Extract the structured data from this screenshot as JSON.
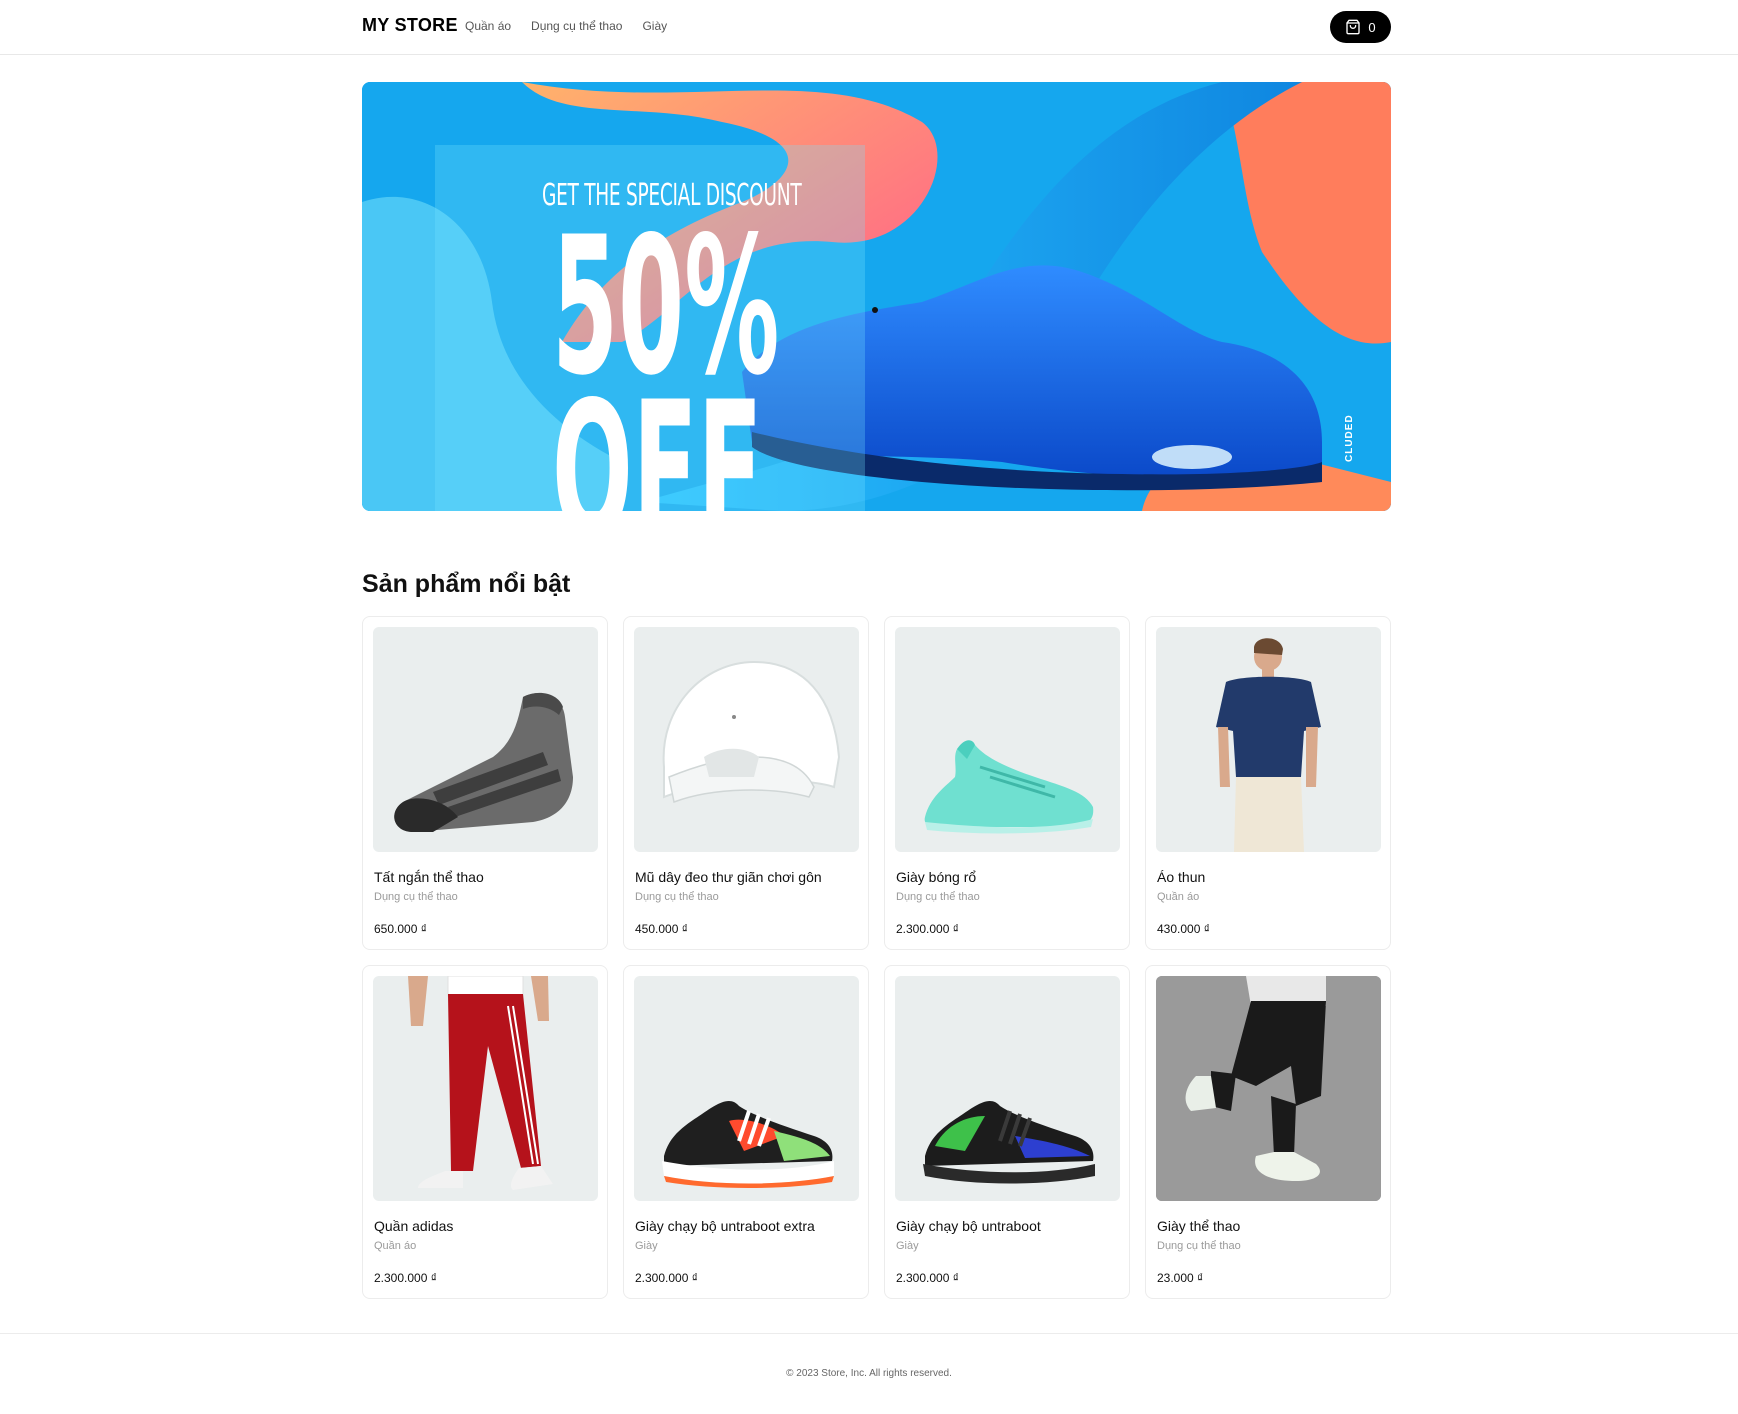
{
  "header": {
    "logo": "MY STORE",
    "nav": [
      "Quần áo",
      "Dụng cụ thể thao",
      "Giày"
    ],
    "cart_count": "0"
  },
  "banner": {
    "headline": "GET THE SPECIAL DISCOUNT",
    "percent": "50%",
    "off": "OFF",
    "side_text": "CLUDED"
  },
  "section_title": "Sản phẩm nổi bật",
  "products": [
    {
      "name": "Tất ngắn thể thao",
      "category": "Dụng cụ thể thao",
      "price": "650.000 ₫",
      "icon": "sock-icon"
    },
    {
      "name": "Mũ dây đeo thư giãn chơi gôn",
      "category": "Dụng cụ thể thao",
      "price": "450.000 ₫",
      "icon": "cap-icon"
    },
    {
      "name": "Giày bóng rổ",
      "category": "Dụng cụ thể thao",
      "price": "2.300.000 ₫",
      "icon": "basketball-shoe-icon"
    },
    {
      "name": "Áo thun",
      "category": "Quần áo",
      "price": "430.000 ₫",
      "icon": "tshirt-model-icon"
    },
    {
      "name": "Quần adidas",
      "category": "Quần áo",
      "price": "2.300.000 ₫",
      "icon": "pants-model-icon"
    },
    {
      "name": "Giày chạy bộ untraboot extra",
      "category": "Giày",
      "price": "2.300.000 ₫",
      "icon": "running-shoe-icon"
    },
    {
      "name": "Giày chạy bộ untraboot",
      "category": "Giày",
      "price": "2.300.000 ₫",
      "icon": "running-shoe-dark-icon"
    },
    {
      "name": "Giày thể thao",
      "category": "Dụng cụ thể thao",
      "price": "23.000 ₫",
      "icon": "sneaker-model-icon"
    }
  ],
  "footer": "© 2023 Store, Inc. All rights reserved.",
  "colors": {
    "banner_blue": "#15a7ee",
    "banner_orange": "#ff7d5c",
    "product_bg": "#eaeeee",
    "cart_bg": "#000000"
  }
}
